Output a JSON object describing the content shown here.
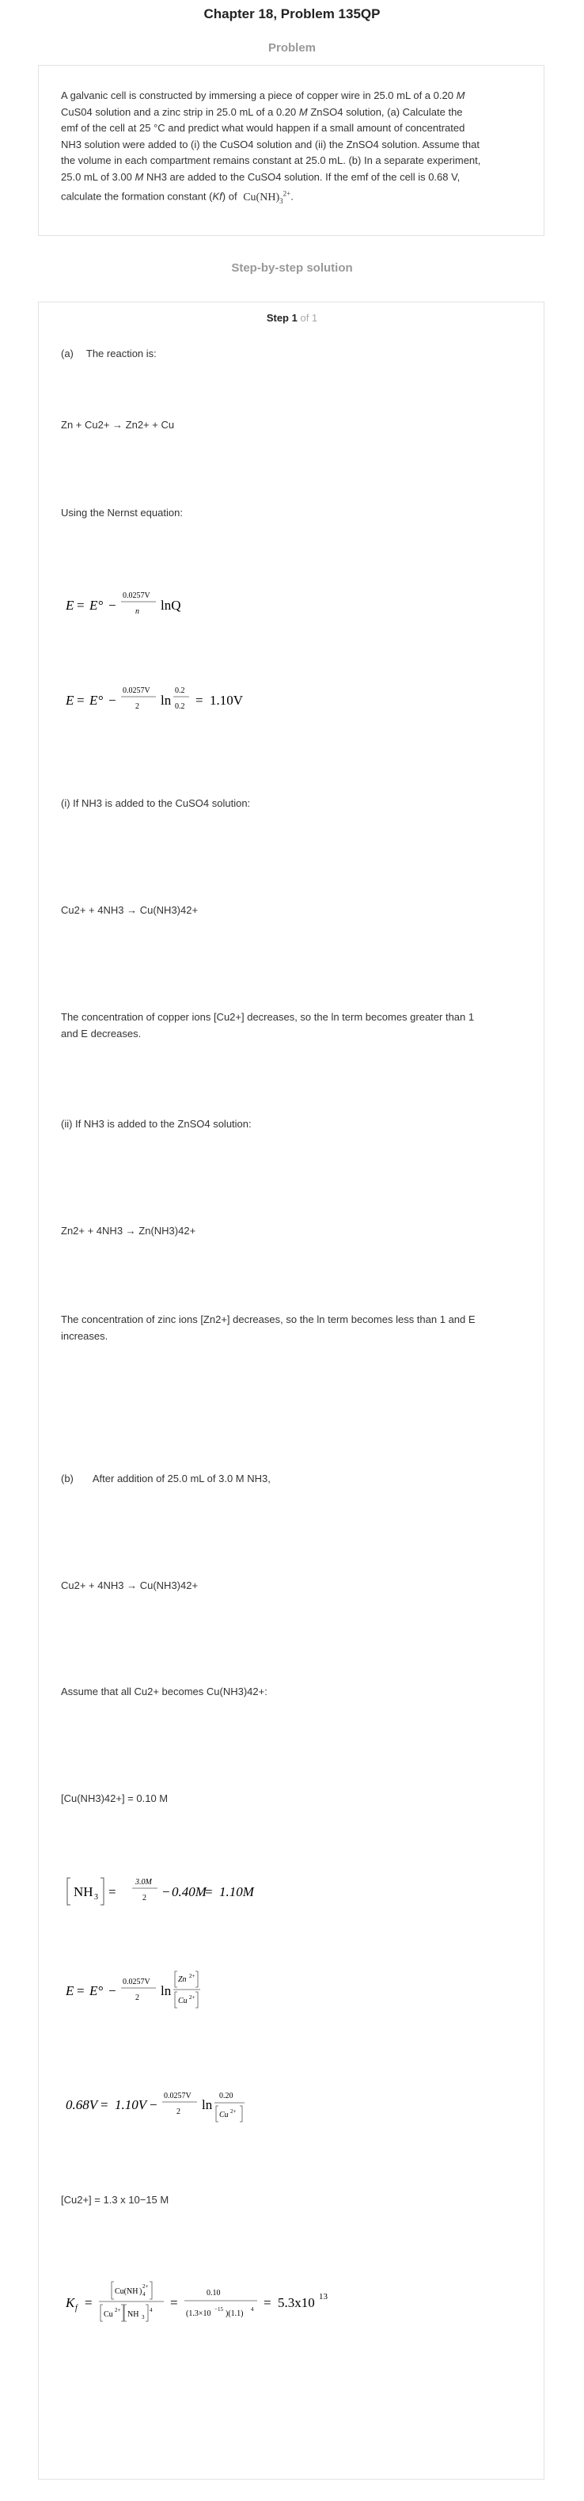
{
  "header": {
    "title": "Chapter 18, Problem 135QP"
  },
  "problem": {
    "label": "Problem",
    "line1a": "A galvanic cell is constructed by immersing a piece of copper wire in 25.0 mL of a 0.20 ",
    "line1m": "M",
    "line2a": "CuS04 solution and a zinc strip in 25.0 mL of a 0.20 ",
    "line2m": "M",
    "line2b": " ZnSO4 solution, (a) Calculate the",
    "line3": "emf of the cell at 25 °C and predict what would happen if a small amount of concentrated",
    "line4": "NH3 solution were added to (i) the CuSO4 solution and (ii) the ZnSO4 solution. Assume that",
    "line5": "the volume in each compartment remains constant at 25.0 mL. (b) In a separate experiment,",
    "line6a": "25.0 mL of 3.00 ",
    "line6m": "M",
    "line6b": " NH3 are added to the CuSO4 solution. If the emf of the cell is 0.68 V,",
    "line7a": "calculate the formation constant (",
    "line7k": "Kf",
    "line7b": ") of",
    "line7c": "."
  },
  "solution": {
    "label": "Step-by-step solution",
    "step_label": "Step 1",
    "step_of": "of 1",
    "a_label": "(a)",
    "a_text": "The reaction is:",
    "reaction1": "Zn + Cu2+ → Zn2+ + Cu",
    "nernst_intro": "Using the Nernst equation:",
    "i_text": "(i) If NH3 is added to the CuSO4 solution:",
    "reaction2": "Cu2+ + 4NH3 → Cu(NH3)42+",
    "i_conclusion_1": "The concentration of copper ions [Cu2+] decreases, so the ln term becomes greater than 1",
    "i_conclusion_2": "and E decreases.",
    "ii_text": "(ii) If NH3 is added to the ZnSO4 solution:",
    "reaction3": "Zn2+ + 4NH3 → Zn(NH3)42+",
    "ii_conclusion_1": "The concentration of zinc ions [Zn2+] decreases, so the ln term becomes less than 1 and E",
    "ii_conclusion_2": "increases.",
    "b_label": "(b)",
    "b_text": "After addition of 25.0 mL of 3.0 M NH3,",
    "reaction4": "Cu2+ + 4NH3 → Cu(NH3)42+",
    "assume": "Assume that all Cu2+ becomes Cu(NH3)42+:",
    "conc_complex": "[Cu(NH3)42+] = 0.10 M",
    "conc_cu": "[Cu2+] = 1.3 x 10−15 M"
  },
  "math": {
    "E": "E",
    "Eo": "E°",
    "eq": "=",
    "minus": "−",
    "f0257V": "0.0257V",
    "n": "n",
    "lnQ": "lnQ",
    "two": "2",
    "ln": "ln",
    "p02": "0.2",
    "v110": "1.10V",
    "nh3_conc": "NH",
    "m30": "3.0M",
    "m040": "0.40M",
    "m110": "1.10M",
    "zn2": "Zn",
    "cu2": "Cu",
    "v068": "0.68V",
    "p020": "0.20",
    "kf": "K",
    "kf_sub": "f",
    "p010": "0.10",
    "den_kf": "(1.3×10",
    "den_exp": "−15",
    "den_rest": ")(1.1)",
    "kf_val": "5.3x10",
    "kf_exp": "13",
    "sub3": "3",
    "sub4": "4",
    "sup2p": "2+",
    "cu_nh3": "Cu(NH",
    "sup4": "4"
  }
}
